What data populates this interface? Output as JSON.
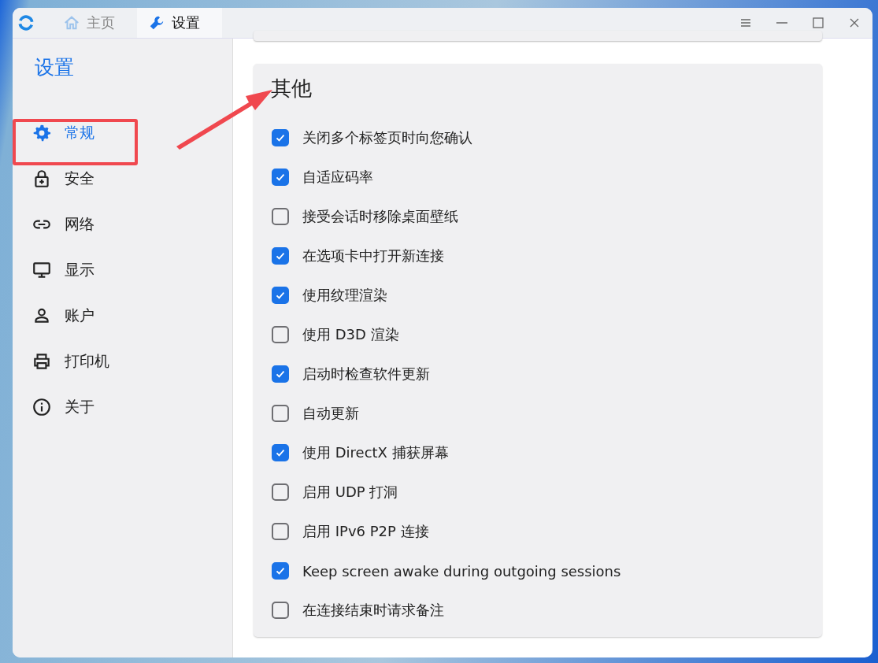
{
  "tabs": [
    {
      "label": "主页",
      "kind": "home",
      "selected": false
    },
    {
      "label": "设置",
      "kind": "wrench",
      "selected": true
    }
  ],
  "sidebar": {
    "title": "设置",
    "items": [
      {
        "label": "常规",
        "kind": "gear",
        "selected": true
      },
      {
        "label": "安全",
        "kind": "lock",
        "selected": false
      },
      {
        "label": "网络",
        "kind": "link",
        "selected": false
      },
      {
        "label": "显示",
        "kind": "monitor",
        "selected": false
      },
      {
        "label": "账户",
        "kind": "person",
        "selected": false
      },
      {
        "label": "打印机",
        "kind": "printer",
        "selected": false
      },
      {
        "label": "关于",
        "kind": "info",
        "selected": false
      }
    ]
  },
  "section": {
    "title": "其他",
    "options": [
      {
        "label": "关闭多个标签页时向您确认",
        "checked": true
      },
      {
        "label": "自适应码率",
        "checked": true
      },
      {
        "label": "接受会话时移除桌面壁纸",
        "checked": false
      },
      {
        "label": "在选项卡中打开新连接",
        "checked": true
      },
      {
        "label": "使用纹理渲染",
        "checked": true
      },
      {
        "label": "使用 D3D 渲染",
        "checked": false
      },
      {
        "label": "启动时检查软件更新",
        "checked": true
      },
      {
        "label": "自动更新",
        "checked": false
      },
      {
        "label": "使用 DirectX 捕获屏幕",
        "checked": true
      },
      {
        "label": "启用 UDP 打洞",
        "checked": false
      },
      {
        "label": "启用 IPv6 P2P 连接",
        "checked": false
      },
      {
        "label": "Keep screen awake during outgoing sessions",
        "checked": true
      },
      {
        "label": "在连接结束时请求备注",
        "checked": false
      }
    ]
  }
}
